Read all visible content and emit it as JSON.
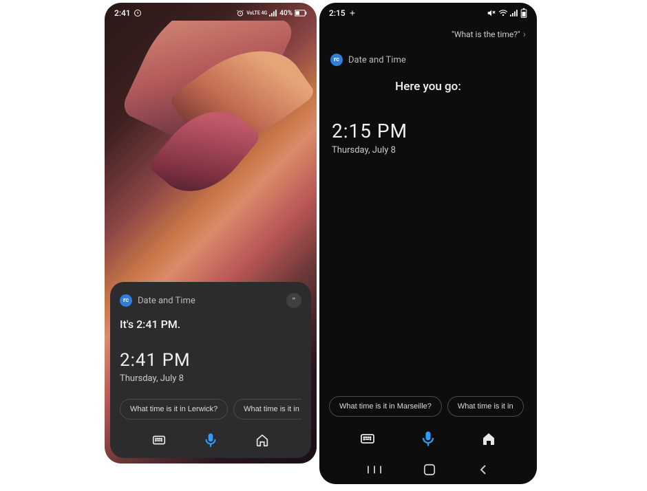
{
  "left": {
    "status": {
      "time": "2:41",
      "network_label": "VoLTE 4G",
      "battery": "40%"
    },
    "card": {
      "title": "Date and Time",
      "response": "It's 2:41 PM.",
      "time": "2:41  PM",
      "date": "Thursday, July 8",
      "chips": [
        "What time is it in Lerwick?",
        "What time is it in Vale"
      ],
      "quote_symbol": "❞"
    }
  },
  "right": {
    "status": {
      "time": "2:15"
    },
    "query": "\"What is the time?\"",
    "card": {
      "title": "Date and Time",
      "heading": "Here you go:",
      "time": "2:15  PM",
      "date": "Thursday, July 8",
      "chips": [
        "What time is it in Marseille?",
        "What time is it in"
      ]
    }
  }
}
